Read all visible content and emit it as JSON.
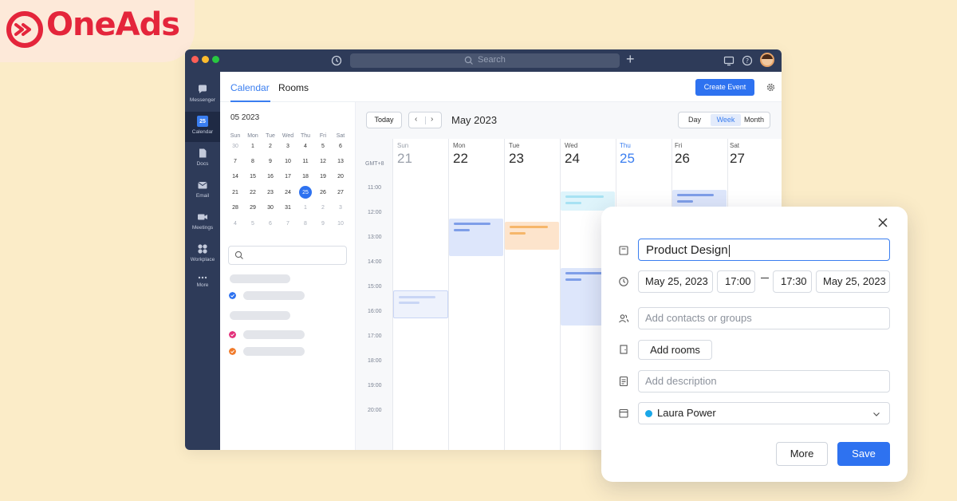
{
  "brand": {
    "name": "OneAds",
    "accent": "#e4253b"
  },
  "titlebar": {
    "search_placeholder": "Search"
  },
  "sidenav": {
    "items": [
      {
        "label": "Messenger",
        "icon": "chat-icon"
      },
      {
        "label": "Calendar",
        "icon": "calendar-icon",
        "badge": "25",
        "active": true
      },
      {
        "label": "Docs",
        "icon": "docs-icon"
      },
      {
        "label": "Email",
        "icon": "mail-icon"
      },
      {
        "label": "Meetings",
        "icon": "video-icon"
      },
      {
        "label": "Workplace",
        "icon": "grid-icon"
      },
      {
        "label": "More",
        "icon": "more-icon"
      }
    ]
  },
  "header": {
    "tabs": [
      {
        "label": "Calendar",
        "active": true
      },
      {
        "label": "Rooms"
      }
    ],
    "create_event": "Create Event"
  },
  "mini_calendar": {
    "title": "05 2023",
    "weekdays": [
      "Sun",
      "Mon",
      "Tue",
      "Wed",
      "Thu",
      "Fri",
      "Sat"
    ],
    "weeks": [
      [
        "30",
        "1",
        "2",
        "3",
        "4",
        "5",
        "6"
      ],
      [
        "7",
        "8",
        "9",
        "10",
        "11",
        "12",
        "13"
      ],
      [
        "14",
        "15",
        "16",
        "17",
        "18",
        "19",
        "20"
      ],
      [
        "21",
        "22",
        "23",
        "24",
        "25",
        "26",
        "27"
      ],
      [
        "28",
        "29",
        "30",
        "31",
        "1",
        "2",
        "3"
      ],
      [
        "4",
        "5",
        "6",
        "7",
        "8",
        "9",
        "10"
      ]
    ],
    "selected": "25"
  },
  "main": {
    "today_label": "Today",
    "prev": "‹",
    "next": "›",
    "month_title": "May 2023",
    "views": [
      "Day",
      "Week",
      "Month"
    ],
    "active_view": "Week",
    "timezone": "GMT+8",
    "hours": [
      "11:00",
      "12:00",
      "13:00",
      "14:00",
      "15:00",
      "16:00",
      "17:00",
      "18:00",
      "19:00",
      "20:00"
    ],
    "days": [
      {
        "name": "Sun",
        "date": "21"
      },
      {
        "name": "Mon",
        "date": "22"
      },
      {
        "name": "Tue",
        "date": "23"
      },
      {
        "name": "Wed",
        "date": "24"
      },
      {
        "name": "Thu",
        "date": "25"
      },
      {
        "name": "Fri",
        "date": "26"
      },
      {
        "name": "Sat",
        "date": "27"
      }
    ]
  },
  "dialog": {
    "title_value": "Product Design",
    "start_date": "May 25, 2023",
    "start_time": "17:00",
    "end_time": "17:30",
    "end_date": "May 25, 2023",
    "contacts_placeholder": "Add contacts or groups",
    "add_rooms": "Add rooms",
    "description_placeholder": "Add description",
    "calendar_owner": "Laura Power",
    "more_label": "More",
    "save_label": "Save"
  },
  "colors": {
    "primary": "#2e72f0",
    "sidebar": "#2e3b59",
    "background": "#fbecc8"
  }
}
